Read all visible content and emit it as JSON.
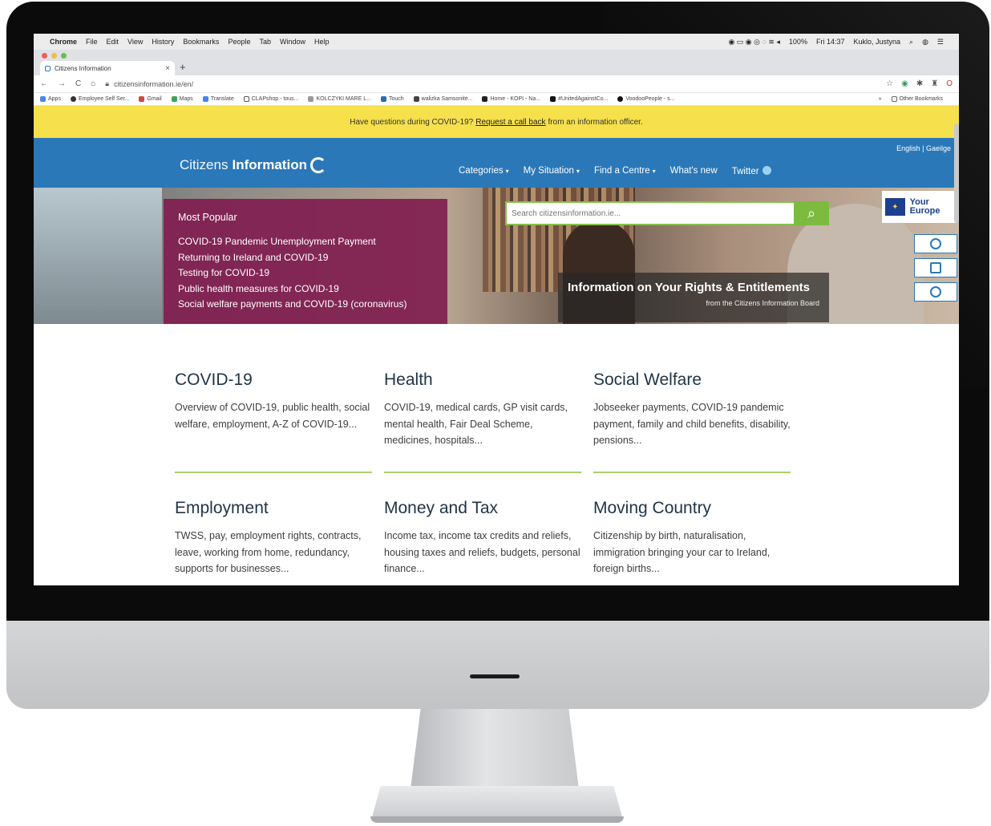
{
  "macmenu": {
    "app": "Chrome",
    "items": [
      "File",
      "Edit",
      "View",
      "History",
      "Bookmarks",
      "People",
      "Tab",
      "Window",
      "Help"
    ],
    "battery": "100%",
    "clock": "Fri 14:37",
    "user": "Kuklo, Justyna"
  },
  "browser": {
    "tab_title": "Citizens Information",
    "url": "citizensinformation.ie/en/",
    "bookmarks": [
      "Apps",
      "Employee Self Ser...",
      "Gmail",
      "Maps",
      "Translate",
      "CLAPshop - tous...",
      "KOLCZYKI MARE L...",
      "Touch",
      "walizka Samsonite...",
      "Home - KOPI - Na...",
      "#UnitedAgainstCo...",
      "VoodooPeople - s..."
    ],
    "other_bookmarks": "Other Bookmarks"
  },
  "banner": {
    "pre": "Have questions during COVID-19?",
    "link": "Request a call back",
    "post": "from an information officer."
  },
  "header": {
    "lang": "English | Gaeilge",
    "logo_thin": "Citizens",
    "logo_bold": "Information",
    "nav": [
      {
        "label": "Categories",
        "caret": "▾"
      },
      {
        "label": "My Situation",
        "caret": "▾"
      },
      {
        "label": "Find a Centre",
        "caret": "▾"
      },
      {
        "label": "What's new",
        "caret": ""
      },
      {
        "label": "Twitter",
        "caret": ""
      }
    ]
  },
  "hero": {
    "popular_title": "Most Popular",
    "popular_items": [
      "COVID-19 Pandemic Unemployment Payment",
      "Returning to Ireland and COVID-19",
      "Testing for COVID-19",
      "Public health measures for COVID-19",
      "Social welfare payments and COVID-19 (coronavirus)"
    ],
    "search_placeholder": "Search citizensinformation.ie...",
    "rights_title": "Information on Your Rights & Entitlements",
    "rights_sub": "from the Citizens Information Board",
    "your_europe": "Your Europe"
  },
  "cards": [
    {
      "title": "COVID-19",
      "text": "Overview of COVID-19, public health, social welfare, employment, A-Z of COVID-19..."
    },
    {
      "title": "Health",
      "text": "COVID-19, medical cards, GP visit cards, mental health, Fair Deal Scheme, medicines, hospitals..."
    },
    {
      "title": "Social Welfare",
      "text": "Jobseeker payments, COVID-19 pandemic payment, family and child benefits, disability, pensions..."
    },
    {
      "title": "Employment",
      "text": "TWSS, pay, employment rights, contracts, leave, working from home, redundancy, supports for businesses..."
    },
    {
      "title": "Money and Tax",
      "text": "Income tax, income tax credits and reliefs, housing taxes and reliefs, budgets, personal finance..."
    },
    {
      "title": "Moving Country",
      "text": "Citizenship by birth, naturalisation, immigration bringing your car to Ireland, foreign births..."
    }
  ],
  "colors": {
    "header_blue": "#2a78b8",
    "banner_yellow": "#f6e04b",
    "popular_purple": "#801d50",
    "accent_green": "#7dbb3e"
  }
}
